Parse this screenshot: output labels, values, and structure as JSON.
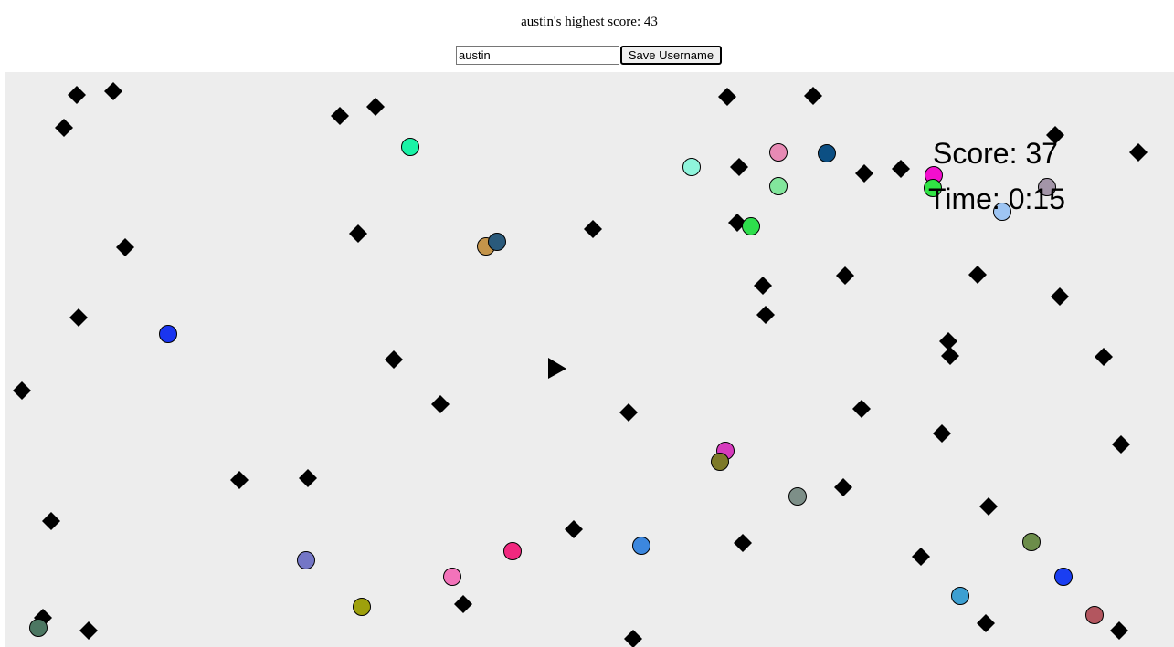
{
  "header": {
    "high_score_text": "austin's highest score: 43"
  },
  "user_form": {
    "username_value": "austin",
    "save_label": "Save Username"
  },
  "game": {
    "score_text": "Score: 37",
    "time_text": "Time: 0:15",
    "colors": {
      "background": "#ededed",
      "obstacle": "#000000",
      "player": "#000000"
    }
  }
}
